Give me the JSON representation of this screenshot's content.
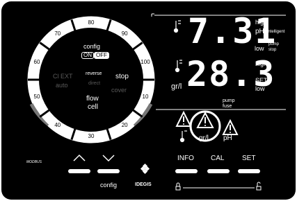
{
  "dial": {
    "scale": [
      "80",
      "90",
      "100",
      "10",
      "20",
      "30",
      "40",
      "50",
      "60",
      "70"
    ],
    "config_label": "config",
    "on_label": "ON",
    "off_label": "OFF",
    "cl_ext": "Cl EXT",
    "auto": "auto",
    "reverse": "reverse",
    "direct": "direct",
    "stop": "stop",
    "cover": "cover",
    "flow_cell_line1": "flow",
    "flow_cell_line2": "cell"
  },
  "ph_display": {
    "value": "7.31",
    "high": "high",
    "ph_label": "pH",
    "intelligent": "intelligent",
    "low": "low",
    "pump": "pump",
    "stop": "stop"
  },
  "cl_display": {
    "value": "28.3",
    "unit": "gr/l",
    "high": "high",
    "set": "SET",
    "low": "low",
    "pump": "pump",
    "fuse": "fuse"
  },
  "alarms": {
    "gr_l": "gr/l",
    "ph": "pH"
  },
  "controls": {
    "modbus": "MODBUS",
    "up_arrow": "⌃",
    "down_arrow": "⌄",
    "config": "config",
    "brand": "IDEGIS",
    "info": "INFO",
    "cal": "CAL",
    "set": "SET"
  },
  "colors": {
    "background": "#000000",
    "foreground": "#ffffff",
    "dim": "#5a5a5a"
  }
}
